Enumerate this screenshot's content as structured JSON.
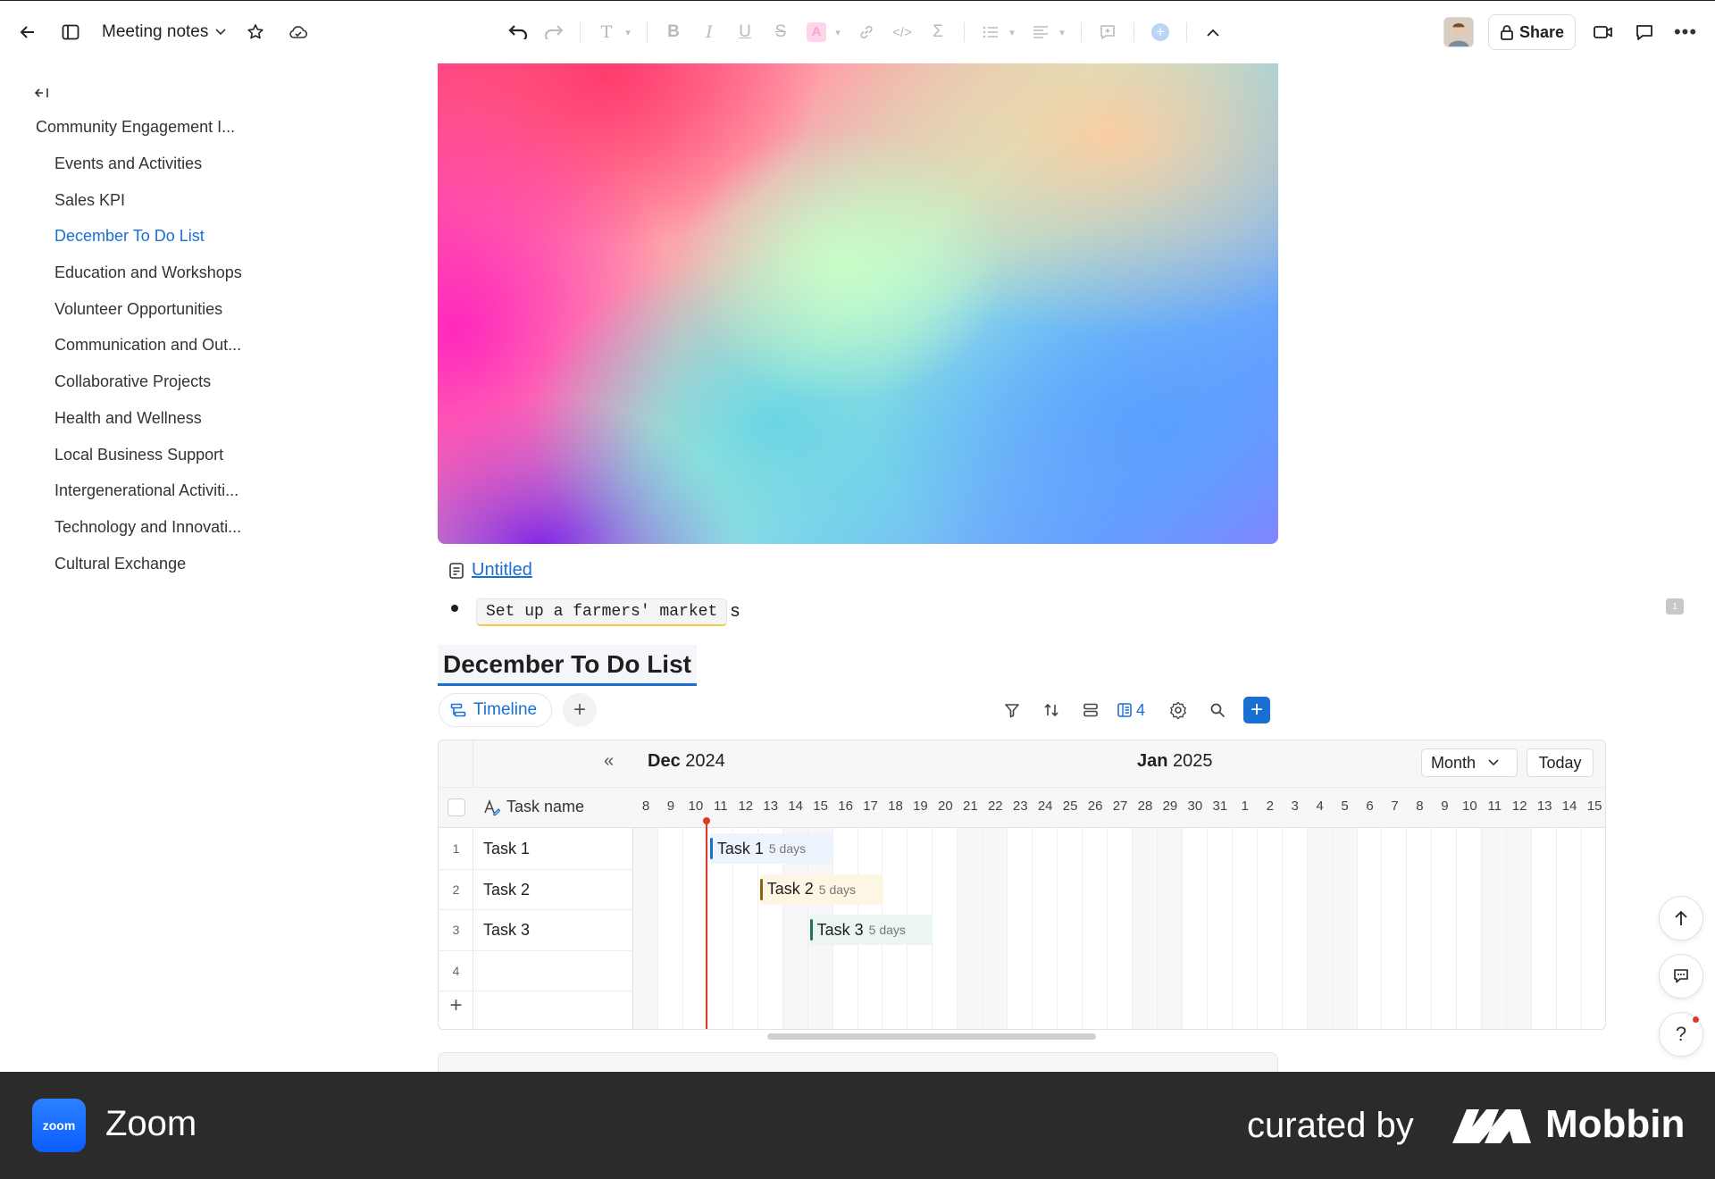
{
  "toolbar": {
    "doc_title": "Meeting notes",
    "share_label": "Share"
  },
  "sidebar": {
    "root": "Community Engagement I...",
    "items": [
      {
        "label": "Events and Activities"
      },
      {
        "label": "Sales KPI"
      },
      {
        "label": "December To Do List",
        "active": true
      },
      {
        "label": "Education and Workshops"
      },
      {
        "label": "Volunteer Opportunities"
      },
      {
        "label": "Communication and Out..."
      },
      {
        "label": "Collaborative Projects"
      },
      {
        "label": "Health and Wellness"
      },
      {
        "label": "Local Business Support"
      },
      {
        "label": "Intergenerational Activiti..."
      },
      {
        "label": "Technology and Innovati..."
      },
      {
        "label": "Cultural Exchange"
      }
    ]
  },
  "content": {
    "page_link": "Untitled",
    "bullet_code": "Set up a farmers' market",
    "bullet_tail": "s",
    "comment_count": "1",
    "database_title": "December To Do List",
    "view_tab": "Timeline",
    "field_count": "4"
  },
  "gantt": {
    "collapse_glyph": "«",
    "column_header": "Task name",
    "month_left": {
      "month": "Dec",
      "year": "2024"
    },
    "month_right": {
      "month": "Jan",
      "year": "2025"
    },
    "scale": "Month",
    "today_label": "Today",
    "days": [
      "8",
      "9",
      "10",
      "11",
      "12",
      "13",
      "14",
      "15",
      "16",
      "17",
      "18",
      "19",
      "20",
      "21",
      "22",
      "23",
      "24",
      "25",
      "26",
      "27",
      "28",
      "29",
      "30",
      "31",
      "1",
      "2",
      "3",
      "4",
      "5",
      "6",
      "7",
      "8",
      "9",
      "10",
      "11",
      "12",
      "13",
      "14",
      "15"
    ],
    "weekend_indices": [
      0,
      6,
      7,
      13,
      14,
      20,
      21,
      27,
      28,
      34,
      35
    ],
    "today_index": 2.95,
    "rows": [
      {
        "num": "1",
        "name": "Task 1"
      },
      {
        "num": "2",
        "name": "Task 2"
      },
      {
        "num": "3",
        "name": "Task 3"
      },
      {
        "num": "4",
        "name": ""
      }
    ],
    "bars": [
      {
        "label": "Task 1",
        "duration": "5 days",
        "start_index": 3,
        "span": 5,
        "row": 0,
        "accent": "#1a6fd3",
        "bg": "#eef4fd"
      },
      {
        "label": "Task 2",
        "duration": "5 days",
        "start_index": 5,
        "span": 5,
        "row": 1,
        "accent": "#8a6412",
        "bg": "#fdf6e4"
      },
      {
        "label": "Task 3",
        "duration": "5 days",
        "start_index": 7,
        "span": 5,
        "row": 2,
        "accent": "#1c7a55",
        "bg": "#eaf6ef"
      }
    ]
  },
  "footer": {
    "app_logo_text": "zoom",
    "app_name": "Zoom",
    "curated_by": "curated by",
    "brand": "Mobbin"
  },
  "colors": {
    "accent": "#1a6fd3",
    "today": "#e0362c"
  }
}
